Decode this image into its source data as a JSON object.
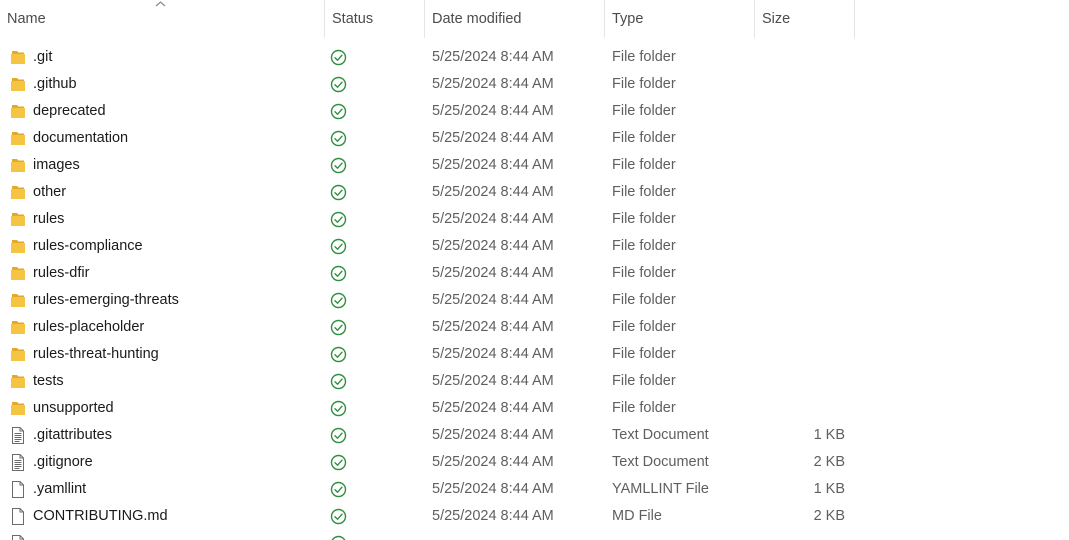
{
  "columns": {
    "name": "Name",
    "status": "Status",
    "date": "Date modified",
    "type": "Type",
    "size": "Size"
  },
  "colors": {
    "folder": "#f6c443",
    "folder_dark": "#e2a92b",
    "status_ok": "#2f8f3f",
    "file_outline": "#6b6b6b"
  },
  "rows": [
    {
      "name": ".git",
      "icon": "folder-icon",
      "status": "synced-check-icon",
      "date": "5/25/2024 8:44 AM",
      "type": "File folder",
      "size": ""
    },
    {
      "name": ".github",
      "icon": "folder-icon",
      "status": "synced-check-icon",
      "date": "5/25/2024 8:44 AM",
      "type": "File folder",
      "size": ""
    },
    {
      "name": "deprecated",
      "icon": "folder-icon",
      "status": "synced-check-icon",
      "date": "5/25/2024 8:44 AM",
      "type": "File folder",
      "size": ""
    },
    {
      "name": "documentation",
      "icon": "folder-icon",
      "status": "synced-check-icon",
      "date": "5/25/2024 8:44 AM",
      "type": "File folder",
      "size": ""
    },
    {
      "name": "images",
      "icon": "folder-icon",
      "status": "synced-check-icon",
      "date": "5/25/2024 8:44 AM",
      "type": "File folder",
      "size": ""
    },
    {
      "name": "other",
      "icon": "folder-icon",
      "status": "synced-check-icon",
      "date": "5/25/2024 8:44 AM",
      "type": "File folder",
      "size": ""
    },
    {
      "name": "rules",
      "icon": "folder-icon",
      "status": "synced-check-icon",
      "date": "5/25/2024 8:44 AM",
      "type": "File folder",
      "size": ""
    },
    {
      "name": "rules-compliance",
      "icon": "folder-icon",
      "status": "synced-check-icon",
      "date": "5/25/2024 8:44 AM",
      "type": "File folder",
      "size": ""
    },
    {
      "name": "rules-dfir",
      "icon": "folder-icon",
      "status": "synced-check-icon",
      "date": "5/25/2024 8:44 AM",
      "type": "File folder",
      "size": ""
    },
    {
      "name": "rules-emerging-threats",
      "icon": "folder-icon",
      "status": "synced-check-icon",
      "date": "5/25/2024 8:44 AM",
      "type": "File folder",
      "size": ""
    },
    {
      "name": "rules-placeholder",
      "icon": "folder-icon",
      "status": "synced-check-icon",
      "date": "5/25/2024 8:44 AM",
      "type": "File folder",
      "size": ""
    },
    {
      "name": "rules-threat-hunting",
      "icon": "folder-icon",
      "status": "synced-check-icon",
      "date": "5/25/2024 8:44 AM",
      "type": "File folder",
      "size": ""
    },
    {
      "name": "tests",
      "icon": "folder-icon",
      "status": "synced-check-icon",
      "date": "5/25/2024 8:44 AM",
      "type": "File folder",
      "size": ""
    },
    {
      "name": "unsupported",
      "icon": "folder-icon",
      "status": "synced-check-icon",
      "date": "5/25/2024 8:44 AM",
      "type": "File folder",
      "size": ""
    },
    {
      "name": ".gitattributes",
      "icon": "text-document-icon",
      "status": "synced-check-icon",
      "date": "5/25/2024 8:44 AM",
      "type": "Text Document",
      "size": "1 KB"
    },
    {
      "name": ".gitignore",
      "icon": "text-document-icon",
      "status": "synced-check-icon",
      "date": "5/25/2024 8:44 AM",
      "type": "Text Document",
      "size": "2 KB"
    },
    {
      "name": ".yamllint",
      "icon": "blank-file-icon",
      "status": "synced-check-icon",
      "date": "5/25/2024 8:44 AM",
      "type": "YAMLLINT File",
      "size": "1 KB"
    },
    {
      "name": "CONTRIBUTING.md",
      "icon": "blank-file-icon",
      "status": "synced-check-icon",
      "date": "5/25/2024 8:44 AM",
      "type": "MD File",
      "size": "2 KB"
    }
  ],
  "partial_row": {
    "icon": "blank-file-icon",
    "status": "synced-check-icon"
  }
}
